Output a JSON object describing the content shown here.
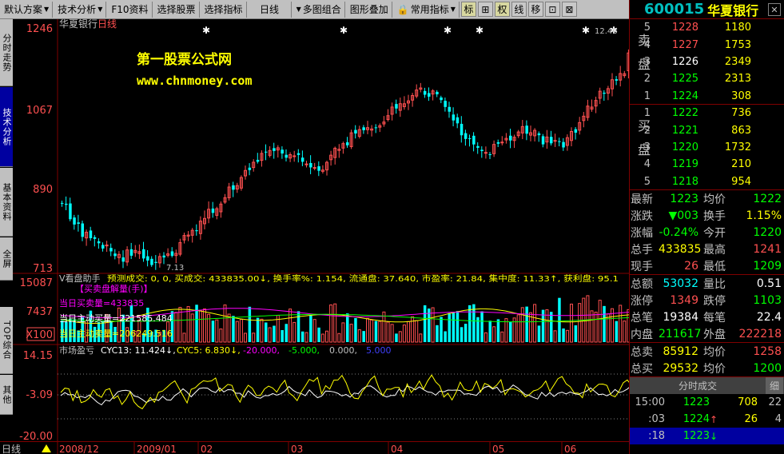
{
  "toolbar": {
    "buttons": [
      "默认方案",
      "技术分析",
      "F10资料",
      "选择股票",
      "选择指标",
      "日线",
      "多图组合",
      "图形叠加",
      "常用指标"
    ],
    "squares": [
      "标",
      "⊞",
      "权",
      "线",
      "移",
      "⊡",
      "⊠"
    ]
  },
  "left_tabs": [
    "分时走势",
    "技术分析",
    "基本资料",
    "全屏",
    "TOP综合",
    "其他"
  ],
  "chart": {
    "stock_label": "华夏银行",
    "period_label": "日线",
    "watermark_line1": "第一股票公式网",
    "watermark_line2": "www.chnmoney.com",
    "price_axis": [
      "1246",
      "1067",
      "890",
      "713"
    ],
    "low_mark": "7.13",
    "high_mark": "12.46",
    "vol_axis": [
      "15087",
      "7437",
      "X100"
    ],
    "vol_indicator_name": "V看盘助手",
    "vol_indicator_line": "预测成交: 0, 0, 买成交: 433835.00↓, 换手率%: 1.154, 流通盘: 37.640, 市盈率: 21.84, 集中度: 11.33↑, 获利盘: 95.1",
    "vol_label_1": "【买卖盘解量(手)】",
    "vol_label_2": "当日买卖量=433835",
    "vol_label_3": "当日主动买量=221585.484",
    "vol_label_4": "当日主动卖量=206249.516",
    "osc_axis": [
      "14.15",
      "-3.09",
      "-20.00"
    ],
    "osc_name": "市场盈亏",
    "osc_cyc13": "CYC13: 11.424↓,",
    "osc_cyc5": "CYC5: 6.830↓,",
    "osc_l1": "-20.000,",
    "osc_l2": "-5.000,",
    "osc_l3": "0.000,",
    "osc_l4": "5.000",
    "date_axis": [
      "2008/12",
      "2009/01",
      "02",
      "03",
      "04",
      "05",
      "06"
    ],
    "bottom_left": "日线"
  },
  "quote": {
    "code": "600015",
    "name": "华夏银行",
    "close_label": "✕",
    "sell_side_label": "卖盘",
    "buy_side_label": "买盘",
    "sell": [
      {
        "lv": "5",
        "price": "1228",
        "vol": "1180"
      },
      {
        "lv": "4",
        "price": "1227",
        "vol": "1753"
      },
      {
        "lv": "3",
        "price": "1226",
        "vol": "2349"
      },
      {
        "lv": "2",
        "price": "1225",
        "vol": "2313"
      },
      {
        "lv": "1",
        "price": "1224",
        "vol": "308"
      }
    ],
    "buy": [
      {
        "lv": "1",
        "price": "1222",
        "vol": "736"
      },
      {
        "lv": "2",
        "price": "1221",
        "vol": "863"
      },
      {
        "lv": "3",
        "price": "1220",
        "vol": "1732"
      },
      {
        "lv": "4",
        "price": "1219",
        "vol": "210"
      },
      {
        "lv": "5",
        "price": "1218",
        "vol": "954"
      }
    ],
    "stats1": [
      {
        "l1": "最新",
        "v1": "1223",
        "c1": "green",
        "l2": "均价",
        "v2": "1222",
        "c2": "green"
      },
      {
        "l1": "涨跌",
        "v1": "▼003",
        "c1": "green",
        "l2": "换手",
        "v2": "1.15%",
        "c2": "yellow"
      },
      {
        "l1": "涨幅",
        "v1": "-0.24%",
        "c1": "green",
        "l2": "今开",
        "v2": "1220",
        "c2": "green"
      },
      {
        "l1": "总手",
        "v1": "433835",
        "c1": "yellow",
        "l2": "最高",
        "v2": "1241",
        "c2": "red"
      },
      {
        "l1": "现手",
        "v1": "26",
        "c1": "red",
        "l2": "最低",
        "v2": "1209",
        "c2": "green"
      }
    ],
    "stats2": [
      {
        "l1": "总额",
        "v1": "53032",
        "c1": "cyan",
        "l2": "量比",
        "v2": "0.51",
        "c2": "white"
      },
      {
        "l1": "涨停",
        "v1": "1349",
        "c1": "red",
        "l2": "跌停",
        "v2": "1103",
        "c2": "green"
      },
      {
        "l1": "总笔",
        "v1": "19384",
        "c1": "white",
        "l2": "每笔",
        "v2": "22.4",
        "c2": "white"
      },
      {
        "l1": "内盘",
        "v1": "211617",
        "c1": "green",
        "l2": "外盘",
        "v2": "222218",
        "c2": "red"
      }
    ],
    "stats3": [
      {
        "l1": "总卖",
        "v1": "85912",
        "c1": "yellow",
        "l2": "均价",
        "v2": "1258",
        "c2": "red"
      },
      {
        "l1": "总买",
        "v1": "29532",
        "c1": "yellow",
        "l2": "均价",
        "v2": "1200",
        "c2": "green"
      }
    ],
    "ticks_title": "分时成交",
    "ticks_tab": "细",
    "ticks": [
      {
        "tm": "15:00",
        "price": "1223",
        "arrow": "",
        "vol": "708",
        "n": "22"
      },
      {
        "tm": ":03",
        "price": "1224",
        "arrow": "↑",
        "vol": "26",
        "n": "4"
      },
      {
        "tm": ":18",
        "price": "1223",
        "arrow": "↓",
        "vol": "",
        "n": ""
      }
    ]
  },
  "colors": {
    "up": "#ff5050",
    "down": "#00ffff",
    "bg": "#000000",
    "grid": "#800000"
  }
}
